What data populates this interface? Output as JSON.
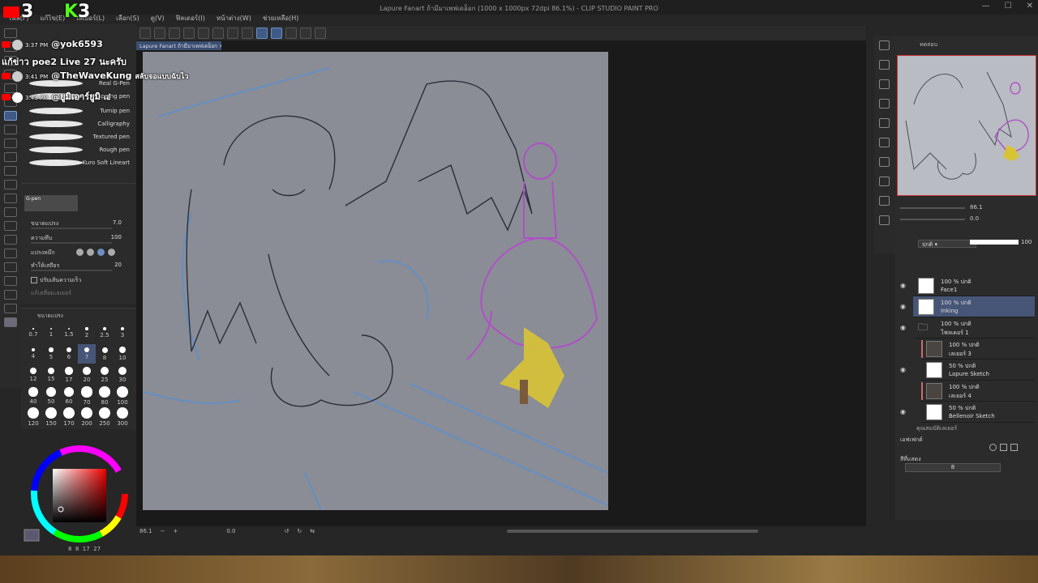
{
  "window": {
    "title": "Lapure Fanart ถ้ามีมาเพฟเดอ็อก (1000 x 1000px 72dpi 86.1%) - CLIP STUDIO PAINT PRO"
  },
  "menu": [
    "ไฟล์(F)",
    "แก้ไข(E)",
    "เลเยอร์(L)",
    "เลือก(S)",
    "ดู(V)",
    "ฟิลเตอร์(I)",
    "หน้าต่าง(W)",
    "ช่วยเหลือ(H)"
  ],
  "overlay": {
    "counters": [
      {
        "icon": "youtube-icon",
        "value": "3",
        "color": "#ff0000"
      },
      {
        "icon": "kick-icon",
        "value": "3",
        "color": "#53fc18"
      }
    ],
    "messages": [
      {
        "time": "3:37 PM",
        "user": "@yok6593",
        "text": "แก้ข่าว poe2 Live 27 นะครับ"
      },
      {
        "time": "3:41 PM",
        "user": "@TheWaveKung",
        "text": "สลับจอแบบฉับไว"
      },
      {
        "time": "3:43 PM",
        "user": "@ยูมิเอาร์ยูมิ",
        "text": "เอ๋"
      }
    ]
  },
  "brushes": [
    "Real G-Pen",
    "Mapping pen",
    "Turnip pen",
    "Calligraphy",
    "Textured pen",
    "Rough pen",
    "Kuro Soft Lineart"
  ],
  "tool_property": {
    "tool_name": "G-pen",
    "rows": [
      {
        "label": "ขนาดแปรง",
        "value": "7.0"
      },
      {
        "label": "ความทึบ",
        "value": "100"
      },
      {
        "label": "แปรงหมึก",
        "value": ""
      },
      {
        "label": "ทำให้เสถียร",
        "value": "20"
      },
      {
        "label": "ปรับเส้นความเร็ว",
        "value": ""
      },
      {
        "label": "แก้เหลี่ยมเลเยอร์",
        "value": ""
      }
    ]
  },
  "size_palette": {
    "label": "ขนาดแปรง",
    "sizes": [
      "0.7",
      "1",
      "1.5",
      "2",
      "2.5",
      "3",
      "4",
      "5",
      "6",
      "7",
      "8",
      "10",
      "12",
      "15",
      "17",
      "20",
      "25",
      "30",
      "40",
      "50",
      "60",
      "70",
      "80",
      "100",
      "120",
      "150",
      "170",
      "200",
      "250",
      "300"
    ],
    "selected": "7"
  },
  "color_panel": {
    "values": "8  8  17  27"
  },
  "canvas": {
    "doc_tab": "Lapure Fanart ถ้ามีมาเพฟเดอ็อก",
    "zoom": "86.1",
    "rotation": "0.0"
  },
  "navigator": {
    "title": "ทดสอบ",
    "zoom": "86.1",
    "angle": "0.0"
  },
  "layers": {
    "blend_mode": "ปกติ",
    "opacity": "100",
    "items": [
      {
        "line1": "100 % ปกติ",
        "line2": "Face1",
        "thumb": "white",
        "selected": false,
        "eye": true,
        "redbar": false,
        "indent": 0
      },
      {
        "line1": "100 % ปกติ",
        "line2": "Inking",
        "thumb": "white",
        "selected": true,
        "eye": true,
        "redbar": false,
        "indent": 0
      },
      {
        "line1": "100 % ปกติ",
        "line2": "โฟลเดอร์ 1",
        "thumb": "folder",
        "selected": false,
        "eye": true,
        "redbar": false,
        "indent": 0
      },
      {
        "line1": "100 % ปกติ",
        "line2": "เลเยอร์ 3",
        "thumb": "dark",
        "selected": false,
        "eye": false,
        "redbar": true,
        "indent": 1
      },
      {
        "line1": "50 % ปกติ",
        "line2": "Lapure Sketch",
        "thumb": "white",
        "selected": false,
        "eye": true,
        "redbar": false,
        "indent": 1
      },
      {
        "line1": "100 % ปกติ",
        "line2": "เลเยอร์ 4",
        "thumb": "dark",
        "selected": false,
        "eye": false,
        "redbar": true,
        "indent": 1
      },
      {
        "line1": "50 % ปกติ",
        "line2": "Bellenoir Sketch",
        "thumb": "white",
        "selected": false,
        "eye": true,
        "redbar": false,
        "indent": 1
      }
    ]
  },
  "properties": {
    "title": "คุณสมบัติเลเยอร์",
    "effect_label": "เอฟเฟกต์",
    "color_label": "สีที่แสดง",
    "color_value": "8"
  }
}
